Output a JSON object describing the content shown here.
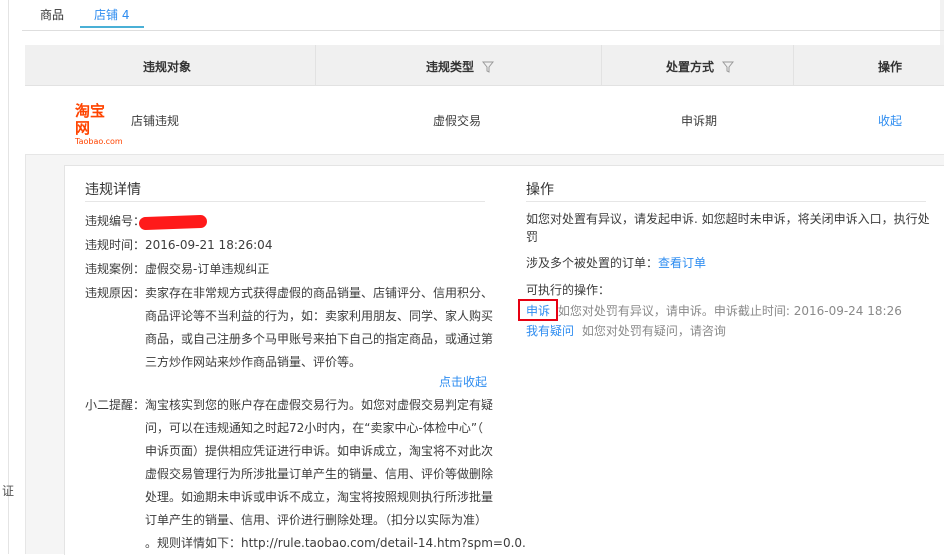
{
  "side": {
    "char": "证"
  },
  "tabs": [
    {
      "label": "商品"
    },
    {
      "label": "店铺 4"
    }
  ],
  "table": {
    "headers": {
      "object": "违规对象",
      "type": "违规类型",
      "method": "处置方式",
      "operation": "操作"
    },
    "row": {
      "logo_cn": "淘宝网",
      "logo_en": "Taobao.com",
      "object": "店铺违规",
      "type": "虚假交易",
      "method": "申诉期",
      "operation": "收起"
    }
  },
  "detail": {
    "title": "违规详情",
    "number_label": "违规编号：",
    "time": "违规时间：2016-09-21 18:26:04",
    "case": "违规案例：虚假交易-订单违规纠正",
    "reason_lines": [
      "违规原因：卖家存在非常规方式获得虚假的商品销量、店铺评分、信用积分、",
      "商品评论等不当利益的行为，如：卖家利用朋友、同学、家人购买",
      "商品，或自己注册多个马甲账号来拍下自己的指定商品，或通过第",
      "三方炒作网站来炒作商品销量、评价等。"
    ],
    "collapse_link": "点击收起",
    "tip_lines": [
      "小二提醒：淘宝核实到您的账户存在虚假交易行为。如您对虚假交易判定有疑",
      "问，可以在违规通知之时起72小时内，在“卖家中心-体检中心”（",
      "申诉页面）提供相应凭证进行申诉。如申诉成立，淘宝将不对此次",
      "虚假交易管理行为所涉批量订单产生的销量、信用、评价等做删除",
      "处理。如逾期未申诉或申诉不成立，淘宝将按照规则执行所涉批量",
      "订单产生的销量、信用、评价进行删除处理。（扣分以实际为准）",
      "。规则详情如下：http://rule.taobao.com/detail-14.htm?spm=0.0."
    ]
  },
  "operation": {
    "title": "操作",
    "notice_lines": [
      "如您对处置有异议，请发起申诉. 如您超时未申诉，将关闭申诉入口，执行处",
      "罚"
    ],
    "orders_label": "涉及多个被处置的订单：",
    "orders_link": "查看订单",
    "available_label": "可执行的操作：",
    "appeal_link": "申诉",
    "appeal_desc": "如您对处罚有异议，请申诉。申诉截止时间: 2016-09-24 18:26",
    "question_link": "我有疑问",
    "question_desc": "如您对处罚有疑问，请咨询"
  },
  "colors": {
    "link": "#2d8cf0",
    "brand": "#ff4400",
    "highlight": "#e60012"
  }
}
